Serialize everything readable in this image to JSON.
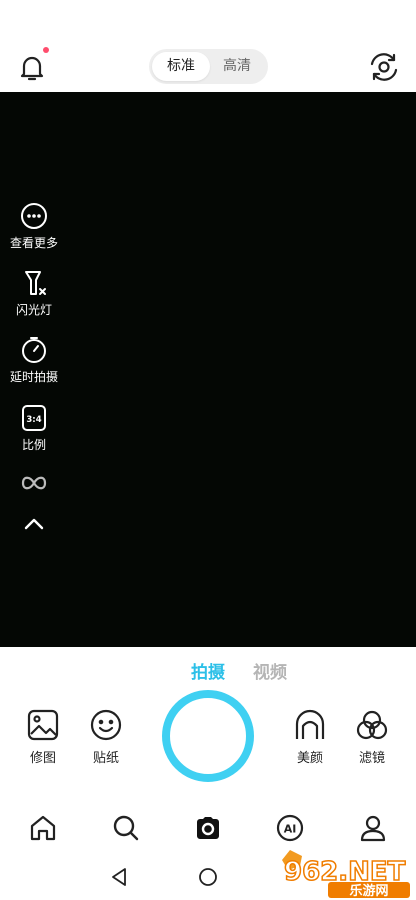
{
  "header": {
    "quality_options": [
      "标准",
      "高清"
    ],
    "selected_quality": "标准",
    "notification_dot_color": "#ff4d6d"
  },
  "sidebar": {
    "items": [
      {
        "label": "查看更多",
        "icon": "more-dots-icon"
      },
      {
        "label": "闪光灯",
        "icon": "flash-off-icon"
      },
      {
        "label": "延时拍摄",
        "icon": "timer-icon"
      },
      {
        "label": "比例",
        "icon": "aspect-ratio-icon",
        "badge": "3:4"
      }
    ],
    "extra_icons": [
      "infinity-icon",
      "chevron-up-icon"
    ]
  },
  "modes": {
    "items": [
      "拍摄",
      "视频"
    ],
    "active": "拍摄",
    "active_color": "#2cc0e8"
  },
  "tools": {
    "left": [
      {
        "label": "修图",
        "icon": "image-edit-icon"
      },
      {
        "label": "贴纸",
        "icon": "smile-sticker-icon"
      }
    ],
    "right": [
      {
        "label": "美颜",
        "icon": "face-beauty-icon"
      },
      {
        "label": "滤镜",
        "icon": "filter-circles-icon"
      }
    ],
    "shutter_color": "#3fd0f2"
  },
  "bottom_nav": {
    "items": [
      "home-icon",
      "search-icon",
      "camera-icon",
      "ai-icon",
      "profile-icon"
    ],
    "ai_text": "AI"
  },
  "system_nav": [
    "back-icon",
    "home-circle-icon"
  ],
  "watermark": {
    "text_top": "962.NET",
    "text_bottom": "乐游网"
  }
}
